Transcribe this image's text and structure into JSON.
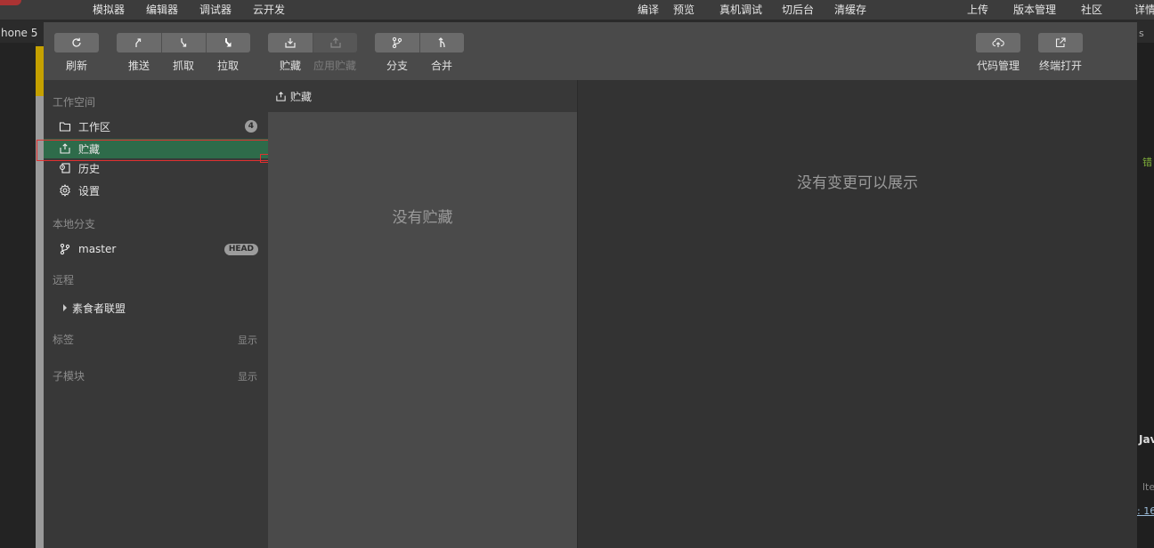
{
  "menubar": {
    "items": [
      "模拟器",
      "编辑器",
      "调试器",
      "云开发",
      "编译",
      "预览",
      "真机调试",
      "切后台",
      "清缓存",
      "上传",
      "版本管理",
      "社区",
      "详情"
    ]
  },
  "background": {
    "device_label": "hone 5",
    "edge_texts": [
      "s",
      "错",
      "Jav",
      "lte",
      ": 16"
    ]
  },
  "toolbar": {
    "refresh": "刷新",
    "push": "推送",
    "fetch": "抓取",
    "pull": "拉取",
    "stash": "贮藏",
    "apply_stash": "应用贮藏",
    "branch": "分支",
    "merge": "合并",
    "code_manage": "代码管理",
    "terminal_open": "终端打开"
  },
  "sidebar": {
    "workspace_title": "工作空间",
    "workspace_items": [
      {
        "label": "工作区",
        "badge": "4"
      },
      {
        "label": "贮藏"
      },
      {
        "label": "历史"
      },
      {
        "label": "设置"
      }
    ],
    "local_branch_title": "本地分支",
    "branch": {
      "label": "master",
      "badge": "HEAD"
    },
    "remote_title": "远程",
    "remote": {
      "label": "素食者联盟"
    },
    "tags_title": "标签",
    "tags_action": "显示",
    "submodule_title": "子模块",
    "submodule_action": "显示"
  },
  "stash_panel": {
    "header": "贮藏",
    "empty": "没有贮藏"
  },
  "diff_panel": {
    "empty": "没有变更可以展示"
  },
  "colors": {
    "selected_bg": "#2e6b4a",
    "highlight_outline": "#e03030"
  }
}
